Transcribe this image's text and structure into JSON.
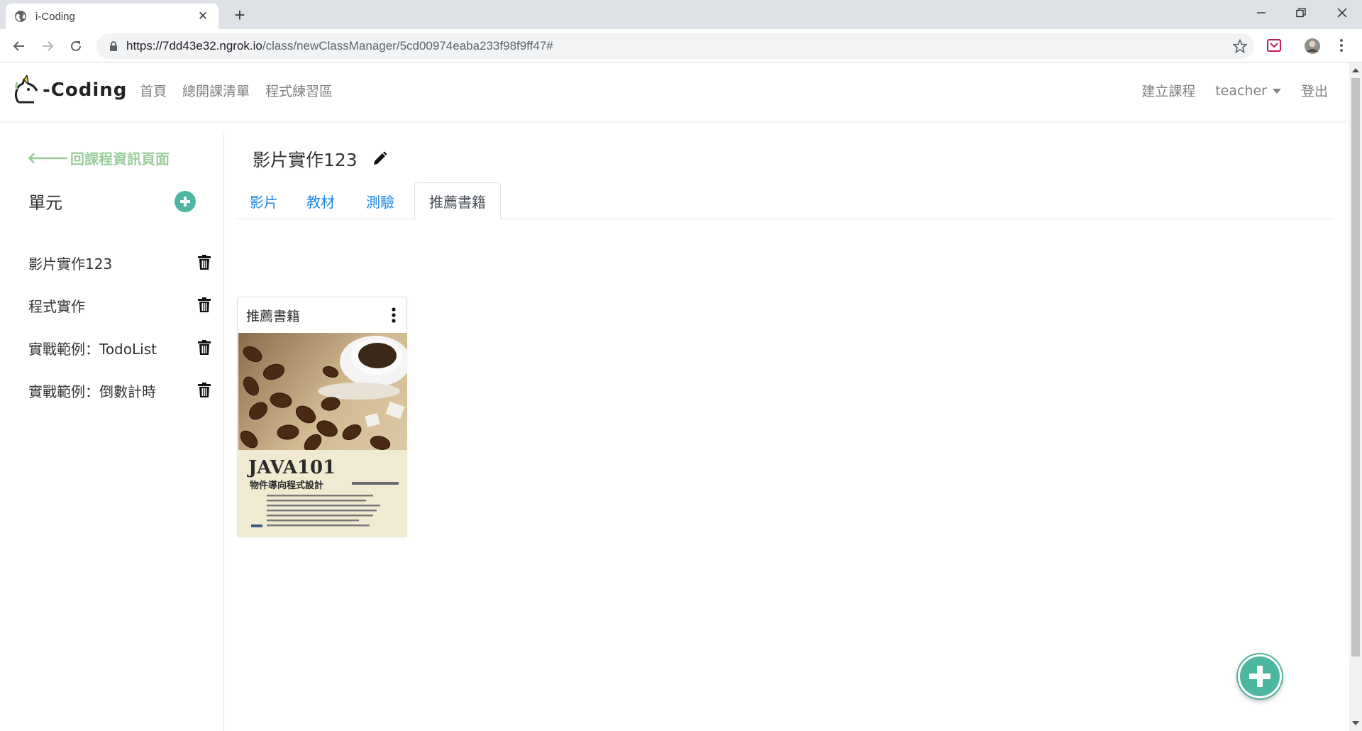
{
  "browser": {
    "tab_title": "i-Coding",
    "tab_close": "✕",
    "new_tab": "+",
    "url_host": "https://7dd43e32.ngrok.io",
    "url_path": "/class/newClassManager/5cd00974eaba233f98f9ff47#"
  },
  "navbar": {
    "brand": "-Coding",
    "links": [
      "首頁",
      "總開課清單",
      "程式練習區"
    ],
    "create_course": "建立課程",
    "user": "teacher",
    "logout": "登出"
  },
  "sidebar": {
    "back_arrow": "🡐",
    "back_label": "回課程資訊頁面",
    "units_title": "單元",
    "units": [
      {
        "label": "影片實作123"
      },
      {
        "label": "程式實作"
      },
      {
        "label": "實戰範例：TodoList"
      },
      {
        "label": "實戰範例：倒數計時"
      }
    ]
  },
  "main": {
    "title": "影片實作123",
    "tabs": [
      {
        "label": "影片"
      },
      {
        "label": "教材"
      },
      {
        "label": "測驗"
      },
      {
        "label": "推薦書籍"
      }
    ],
    "active_tab": "推薦書籍",
    "card": {
      "title": "推薦書籍",
      "book_title": "JAVA101",
      "book_subtitle": "物件導向程式設計"
    }
  },
  "colors": {
    "accent": "#4db6a0",
    "link": "#1e88e5",
    "back_link": "#9ccc9c"
  }
}
